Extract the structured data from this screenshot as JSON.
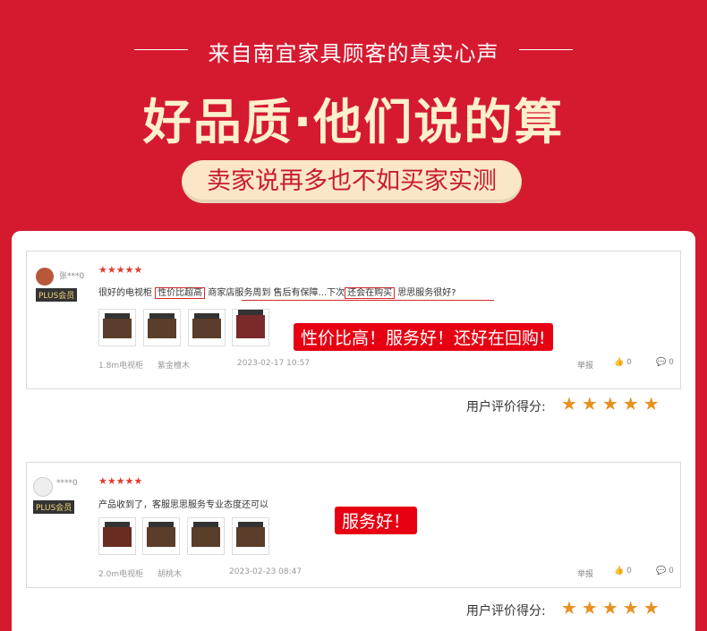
{
  "header": {
    "subheading": "来自南宜家具顾客的真实心声",
    "headline": "好品质·他们说的算",
    "pill": "卖家说再多也不如买家实测"
  },
  "reviews": [
    {
      "username": "张***0",
      "badge": "PLUS会员",
      "stars": "★★★★★",
      "text_1": "很好的电视柜",
      "highlight_1": "性价比超高",
      "text_2": "商家店服务周到 售后有保障...下次",
      "highlight_2": "还会在购买",
      "text_3": "思思服务很好?",
      "meta": [
        "1.8m电视柜",
        "紫金檀木",
        "2023-02-17 10:57"
      ],
      "report": "举报",
      "likes": "0",
      "comments": "0",
      "callout": "性价比高！服务好！还好在回购!",
      "score_label": "用户评价得分:",
      "score_stars": "★★★★★"
    },
    {
      "username": "****0",
      "badge": "PLUS会员",
      "stars": "★★★★★",
      "text": "产品收到了，客服思思服务专业态度还可以",
      "meta": [
        "2.0m电视柜",
        "胡桃木",
        "2023-02-23 08:47"
      ],
      "report": "举报",
      "likes": "0",
      "comments": "0",
      "callout": "服务好！",
      "score_label": "用户评价得分:",
      "score_stars": "★★★★★"
    }
  ]
}
